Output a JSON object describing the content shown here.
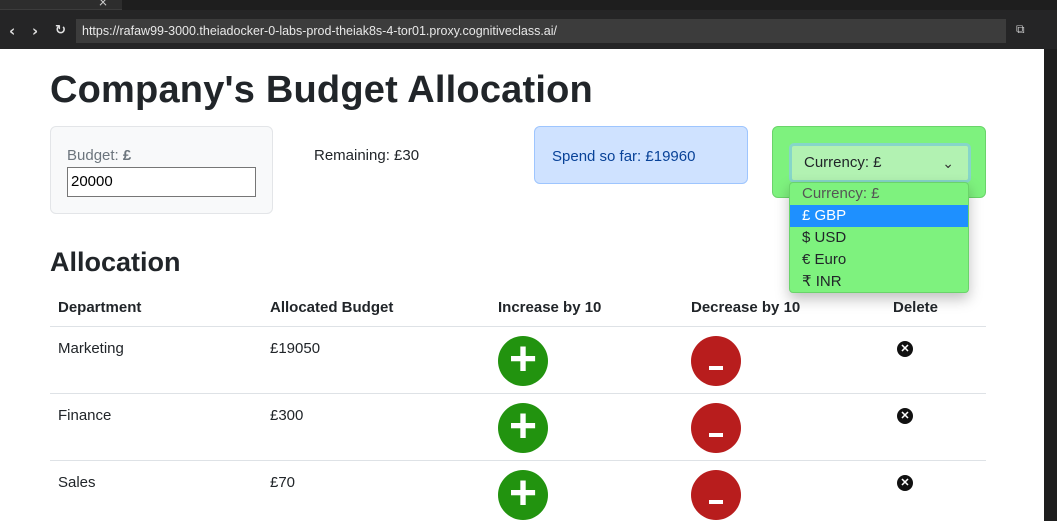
{
  "browser": {
    "url": "https://rafaw99-3000.theiadocker-0-labs-prod-theiak8s-4-tor01.proxy.cognitiveclass.ai/",
    "tab_close": "×",
    "back_icon": "‹",
    "forward_icon": "›",
    "reload_icon": "↻",
    "external_icon": "⧉"
  },
  "page": {
    "title": "Company's Budget Allocation",
    "budget": {
      "label": "Budget: ",
      "currency_symbol": "£",
      "value": "20000"
    },
    "remaining": "Remaining: £30",
    "spend": "Spend so far: £19960",
    "currency": {
      "selected": "Currency: £",
      "chevron": "⌄",
      "options": [
        "Currency: £",
        "£ GBP",
        "$ USD",
        "€ Euro",
        "₹ INR"
      ],
      "highlighted_index": 1
    },
    "allocation_title": "Allocation"
  },
  "table": {
    "headers": [
      "Department",
      "Allocated Budget",
      "Increase by 10",
      "Decrease by 10",
      "Delete"
    ],
    "rows": [
      {
        "department": "Marketing",
        "budget": "£19050"
      },
      {
        "department": "Finance",
        "budget": "£300"
      },
      {
        "department": "Sales",
        "budget": "£70"
      }
    ],
    "plus_symbol": "+",
    "delete_symbol": "✕"
  },
  "colors": {
    "increase": "#22930f",
    "decrease": "#b81d1d",
    "currency_bg": "#7ef27e",
    "spend_bg": "#cfe2ff"
  }
}
